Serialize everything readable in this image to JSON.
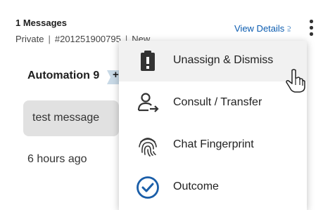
{
  "header": {
    "title": "1 Messages",
    "meta_privacy": "Private",
    "meta_id": "#201251900795",
    "meta_status": "New",
    "view_details_label": "View Details",
    "view_details_icon": "double-chevron-down-icon"
  },
  "conversation": {
    "sender": "Automation 9",
    "message_text": "test message",
    "timestamp": "6 hours ago"
  },
  "menu": {
    "items": [
      {
        "label": "Unassign & Dismiss",
        "icon": "clipboard-alert-icon"
      },
      {
        "label": "Consult / Transfer",
        "icon": "person-arrow-icon"
      },
      {
        "label": "Chat Fingerprint",
        "icon": "fingerprint-icon"
      },
      {
        "label": "Outcome",
        "icon": "check-circle-icon"
      }
    ]
  },
  "colors": {
    "link": "#0b5cb0",
    "outcome_icon": "#1a5ea8",
    "bubble": "#e1e1e1",
    "hover": "#f1f1f1"
  }
}
